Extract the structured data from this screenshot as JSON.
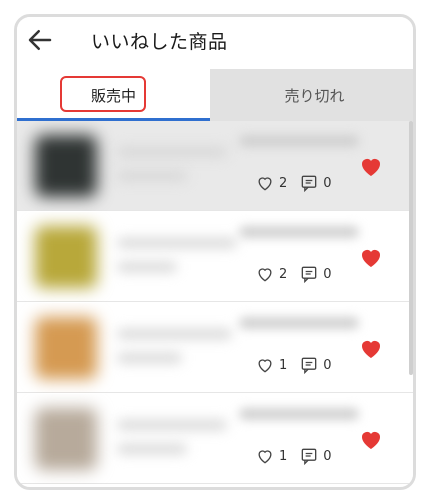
{
  "header": {
    "title": "いいねした商品"
  },
  "tabs": [
    {
      "label": "販売中",
      "selected": true
    },
    {
      "label": "売り切れ",
      "selected": false
    }
  ],
  "items": [
    {
      "likes": "2",
      "comments": "0",
      "liked": true,
      "thumb_color": "#2f3433"
    },
    {
      "likes": "2",
      "comments": "0",
      "liked": true,
      "thumb_color": "#b8a83a"
    },
    {
      "likes": "1",
      "comments": "0",
      "liked": true,
      "thumb_color": "#d59a52"
    },
    {
      "likes": "1",
      "comments": "0",
      "liked": true,
      "thumb_color": "#b7aa9b"
    }
  ],
  "colors": {
    "accent": "#2f6fcf",
    "heart": "#e53935",
    "highlight": "#e53935"
  }
}
